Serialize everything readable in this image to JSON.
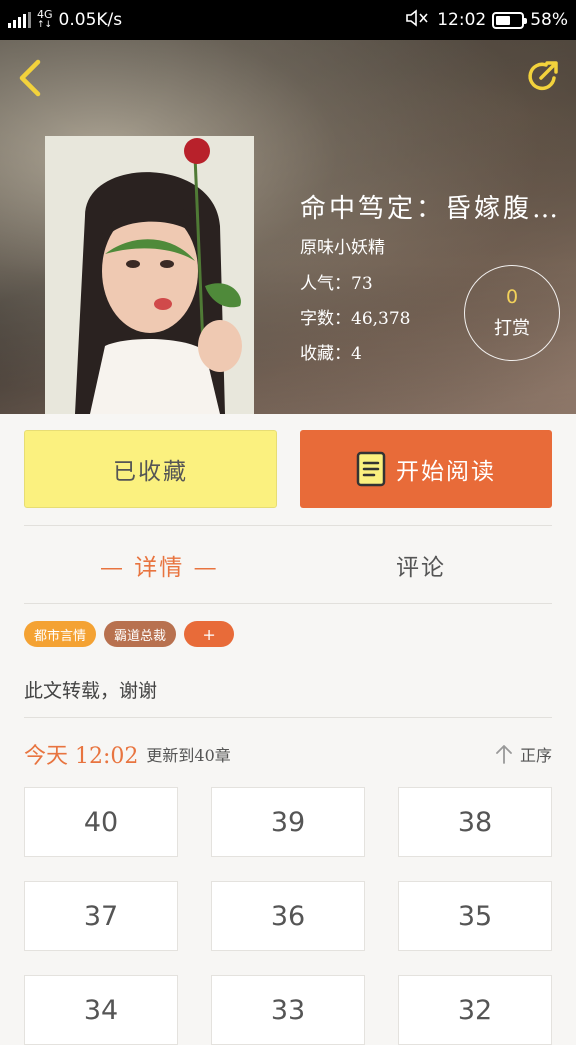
{
  "status_bar": {
    "network_type": "4G",
    "speed": "0.05K/s",
    "time": "12:02",
    "battery": "58%",
    "battery_level": 0.58
  },
  "book": {
    "title": "命中笃定：昏嫁腹…",
    "author": "原味小妖精",
    "popularity": "人气：73",
    "word_count": "字数：46,378",
    "favorites": "收藏：4"
  },
  "tip": {
    "count": "0",
    "label": "打赏"
  },
  "actions": {
    "collected_label": "已收藏",
    "read_label": "开始阅读"
  },
  "tabs": {
    "detail": "— 详情 —",
    "comment": "评论"
  },
  "tags": [
    "都市言情",
    "霸道总裁"
  ],
  "add_tag_label": "+",
  "description": "此文转载，谢谢",
  "update": {
    "time": "今天 12:02",
    "note": "更新到40章",
    "sort_label": "正序"
  },
  "chapters": [
    "40",
    "39",
    "38",
    "37",
    "36",
    "35",
    "34",
    "33",
    "32"
  ],
  "colors": {
    "accent": "#e86b39",
    "collected_bg": "#fbf17f",
    "tag_orange": "#f4a233",
    "tag_brown": "#b8714f"
  }
}
